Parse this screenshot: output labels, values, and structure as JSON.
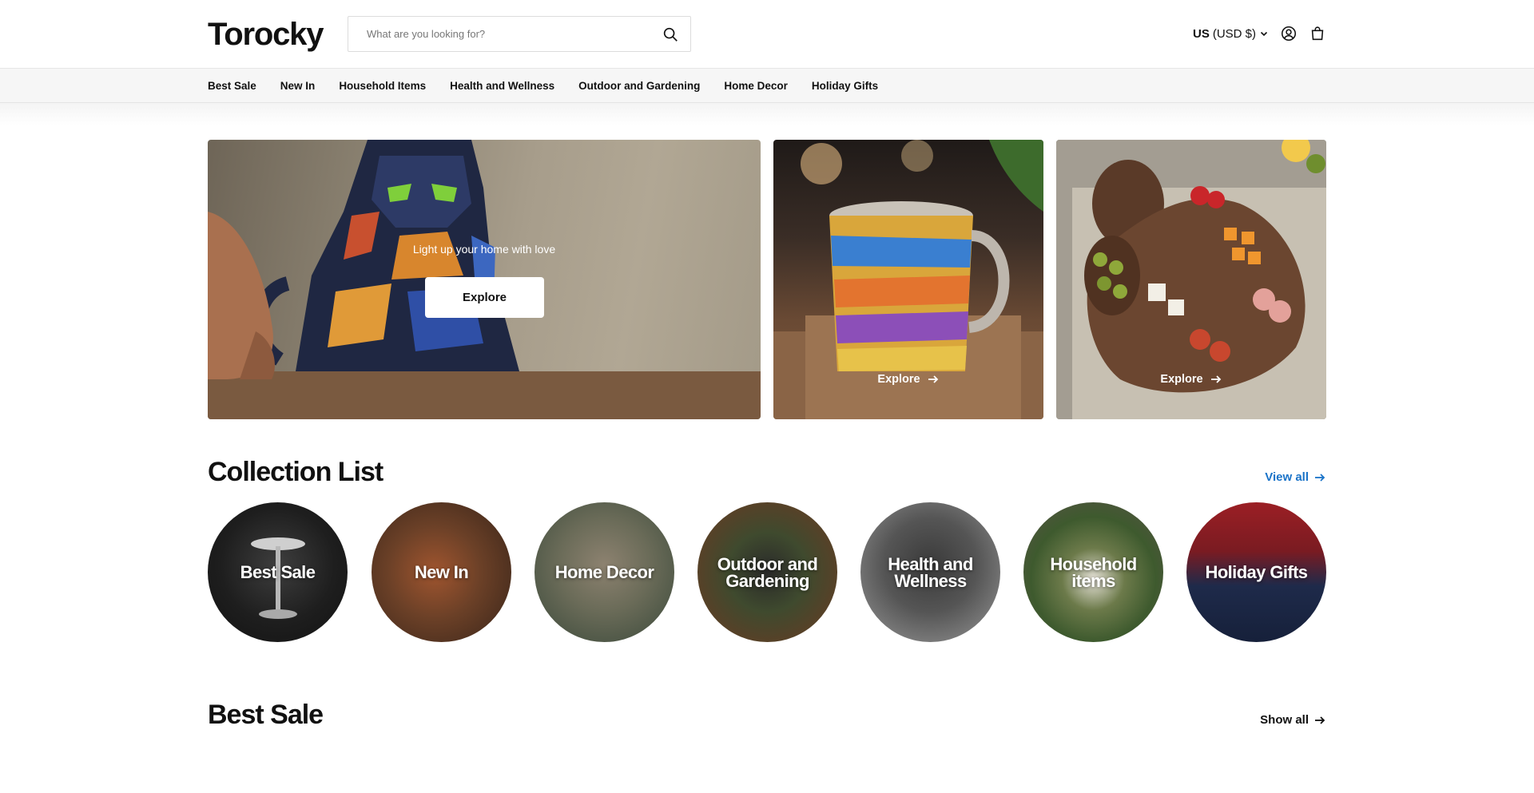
{
  "header": {
    "logo": "Torocky",
    "search_placeholder": "What are you looking for?",
    "currency_country": "US",
    "currency_code": "(USD $)"
  },
  "nav": {
    "items": [
      "Best Sale",
      "New In",
      "Household Items",
      "Health and Wellness",
      "Outdoor and Gardening",
      "Home Decor",
      "Holiday Gifts"
    ]
  },
  "hero": {
    "tagline": "Light up your home with love",
    "button_label": "Explore"
  },
  "banners": [
    {
      "label": "Explore"
    },
    {
      "label": "Explore"
    }
  ],
  "collection": {
    "title": "Collection List",
    "view_all": "View all",
    "view_all_color": "#1a73c8",
    "items": [
      {
        "label": "Best Sale"
      },
      {
        "label": "New In"
      },
      {
        "label": "Home Decor"
      },
      {
        "label": "Outdoor and Gardening"
      },
      {
        "label": "Health and Wellness"
      },
      {
        "label": "Household items"
      },
      {
        "label": "Holiday Gifts"
      }
    ]
  },
  "best_sale": {
    "title": "Best Sale",
    "show_all": "Show all"
  }
}
